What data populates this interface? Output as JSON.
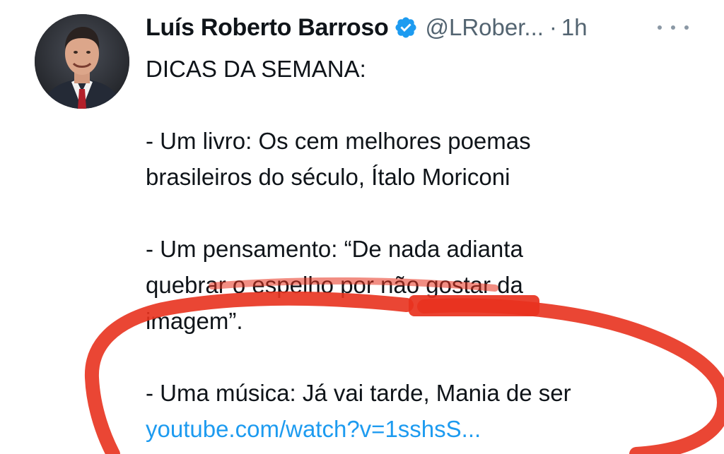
{
  "author": {
    "name": "Luís Roberto Barroso",
    "handle": "@LRober...",
    "separator": "·",
    "time": "1h",
    "avatar_icon": "profile-photo"
  },
  "tweet": {
    "lines": [
      "DICAS DA SEMANA:",
      "- Um livro: Os cem melhores poemas",
      "brasileiros do século, Ítalo Moriconi",
      "- Um pensamento: “De nada adianta",
      "quebrar o espelho por não gostar da",
      "imagem”.",
      "- Uma música: Já vai tarde, Mania de ser"
    ],
    "link": "youtube.com/watch?v=1sshsS..."
  },
  "colors": {
    "verified_blue": "#1d9bf0",
    "link_blue": "#1d9bf0",
    "annotation_red": "#e8321e",
    "text": "#0f1419",
    "muted": "#536471"
  },
  "icons": {
    "verified": "verified-badge-icon",
    "more": "more-options-icon"
  }
}
